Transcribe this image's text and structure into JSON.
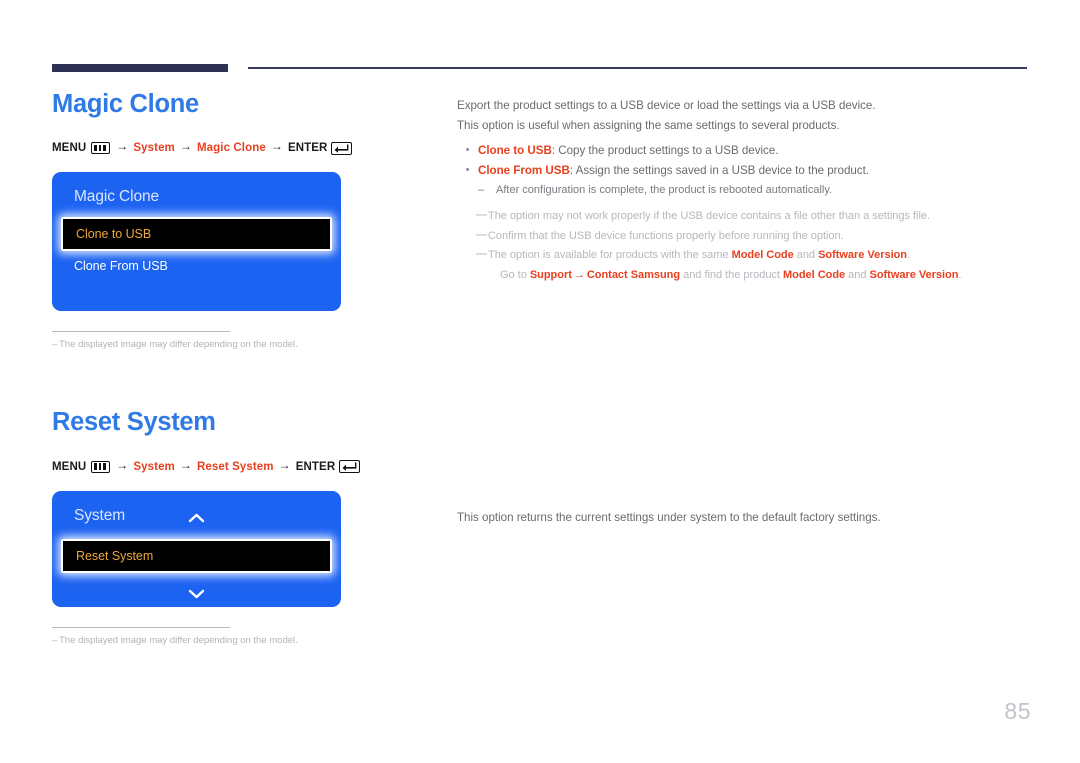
{
  "page": {
    "number": "85"
  },
  "sections": [
    {
      "id": "magic-clone",
      "title": "Magic Clone",
      "breadcrumb": {
        "menu_label": "MENU",
        "menu_icon": "menu-grid-icon",
        "arrow": "→",
        "path_1": "System",
        "path_2": "Magic Clone",
        "enter_label": "ENTER",
        "enter_icon": "enter-key-icon"
      },
      "osd": {
        "title": "Magic Clone",
        "rows": [
          {
            "label": "Clone to USB",
            "selected": true
          },
          {
            "label": "Clone From USB",
            "selected": false
          }
        ],
        "chevron_up": false,
        "chevron_down": false
      },
      "footnote": {
        "dash": "–",
        "text": "The displayed image may differ depending on the model."
      },
      "body": {
        "paragraphs": [
          "Export the product settings to a USB device or load the settings via a USB device.",
          "This option is useful when assigning the same settings to several products."
        ],
        "bullets": [
          {
            "dot": "•",
            "term": "Clone to USB",
            "rest": ": Copy the product settings to a USB device."
          },
          {
            "dot": "•",
            "term": "Clone From USB",
            "rest": ": Assign the settings saved in a USB device to the product."
          }
        ],
        "subnote": {
          "dash": "–",
          "text": "After configuration is complete, the product is rebooted automatically."
        },
        "notes": [
          {
            "dash": "—",
            "text": "The option may not work properly if the USB device contains a file other than a settings file."
          },
          {
            "dash": "—",
            "text": "Confirm that the USB device functions properly before running the option."
          }
        ],
        "note_model": {
          "dash": "—",
          "prefix": "The option is available for products with the same ",
          "term_1": "Model Code",
          "middle": " and ",
          "term_2": "Software Version",
          "suffix": ".",
          "line2_prefix": "Go to ",
          "line2_term_1": "Support",
          "line2_arrow": "→",
          "line2_term_2": "Contact Samsung",
          "line2_middle": " and find the product ",
          "line2_term_3": "Model Code",
          "line2_and": " and ",
          "line2_term_4": "Software Version",
          "line2_suffix": "."
        }
      }
    },
    {
      "id": "reset-system",
      "title": "Reset System",
      "breadcrumb": {
        "menu_label": "MENU",
        "menu_icon": "menu-grid-icon",
        "arrow": "→",
        "path_1": "System",
        "path_2": "Reset System",
        "enter_label": "ENTER",
        "enter_icon": "enter-key-icon"
      },
      "osd": {
        "title": "System",
        "rows": [
          {
            "label": "Reset System",
            "selected": true
          }
        ],
        "chevron_up": true,
        "chevron_down": true
      },
      "footnote": {
        "dash": "–",
        "text": "The displayed image may differ depending on the model."
      },
      "body": {
        "paragraphs": [
          "This option returns the current settings under system to the default factory settings."
        ]
      }
    }
  ],
  "colors": {
    "heading_blue": "#2f7ae5",
    "accent_red": "#e8401f",
    "osd_blue": "#1c63f2",
    "osd_highlight_text": "#eda73a",
    "rule_navy": "#2e3154"
  }
}
